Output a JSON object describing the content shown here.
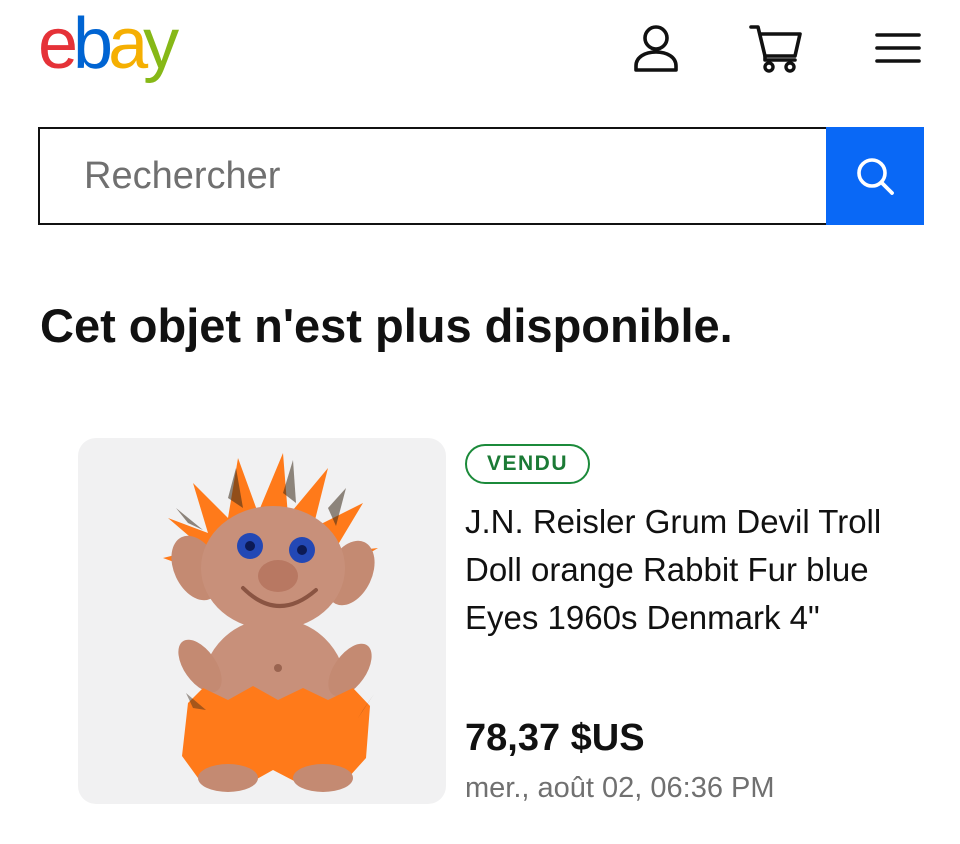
{
  "header": {
    "logo": {
      "letters": [
        "e",
        "b",
        "a",
        "y"
      ],
      "colors": [
        "#e53238",
        "#0064d2",
        "#f5af02",
        "#86b817"
      ]
    },
    "icons": [
      "user-icon",
      "cart-icon",
      "menu-icon"
    ]
  },
  "search": {
    "placeholder": "Rechercher",
    "button_icon": "search-icon",
    "button_color": "#0968f6"
  },
  "main": {
    "title": "Cet objet n'est plus disponible."
  },
  "item": {
    "status": "VENDU",
    "title": "J.N. Reisler Grum Devil Troll Doll orange Rabbit Fur blue Eyes 1960s Denmark 4\"",
    "price": "78,37 $US",
    "date": "mer., août 02, 06:36 PM",
    "status_color": "#1b8a3a"
  }
}
